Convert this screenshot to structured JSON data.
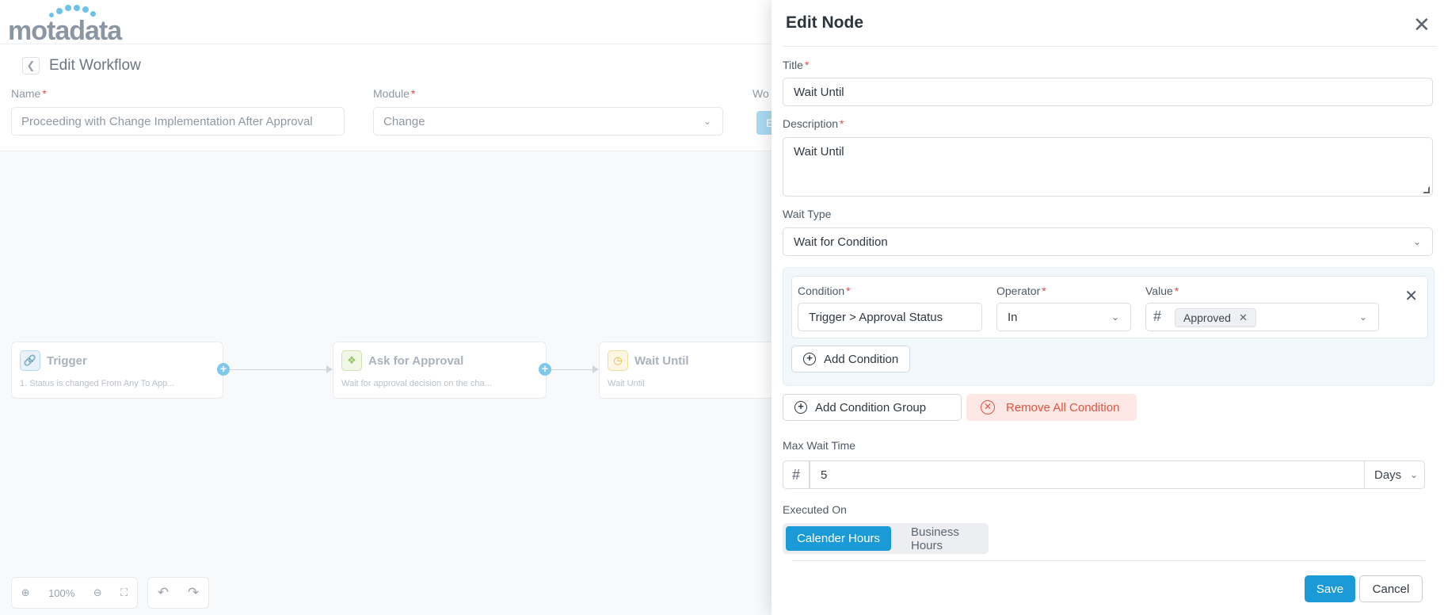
{
  "app": {
    "logo_text": "motadata",
    "page_title": "Edit Workflow"
  },
  "workflow_form": {
    "name_label": "Name",
    "name_value": "Proceeding with Change Implementation After Approval",
    "module_label": "Module",
    "module_value": "Change",
    "partial_label": "Wo",
    "partial_button": "E"
  },
  "canvas": {
    "nodes": [
      {
        "title": "Trigger",
        "subtitle": "1. Status is changed From Any To App...",
        "icon": "link-icon"
      },
      {
        "title": "Ask for Approval",
        "subtitle": "Wait for approval decision on the cha...",
        "icon": "approval-icon"
      },
      {
        "title": "Wait Until",
        "subtitle": "Wait Until",
        "icon": "clock-icon"
      }
    ],
    "zoom_level": "100%"
  },
  "drawer": {
    "title": "Edit Node",
    "title_label": "Title",
    "title_value": "Wait Until",
    "description_label": "Description",
    "description_value": "Wait Until",
    "wait_type_label": "Wait Type",
    "wait_type_value": "Wait for Condition",
    "condition": {
      "condition_label": "Condition",
      "condition_value": "Trigger > Approval Status",
      "operator_label": "Operator",
      "operator_value": "In",
      "value_label": "Value",
      "value_chip": "Approved"
    },
    "add_condition": "Add Condition",
    "add_condition_group": "Add Condition Group",
    "remove_all_condition": "Remove All Condition",
    "max_wait_label": "Max Wait Time",
    "max_wait_value": "5",
    "max_wait_unit": "Days",
    "executed_on_label": "Executed On",
    "executed_on_options": [
      "Calender Hours",
      "Business Hours"
    ],
    "save": "Save",
    "cancel": "Cancel"
  },
  "colors": {
    "accent": "#1a9ad6",
    "danger": "#e5523f",
    "required": "#e34b4b"
  }
}
